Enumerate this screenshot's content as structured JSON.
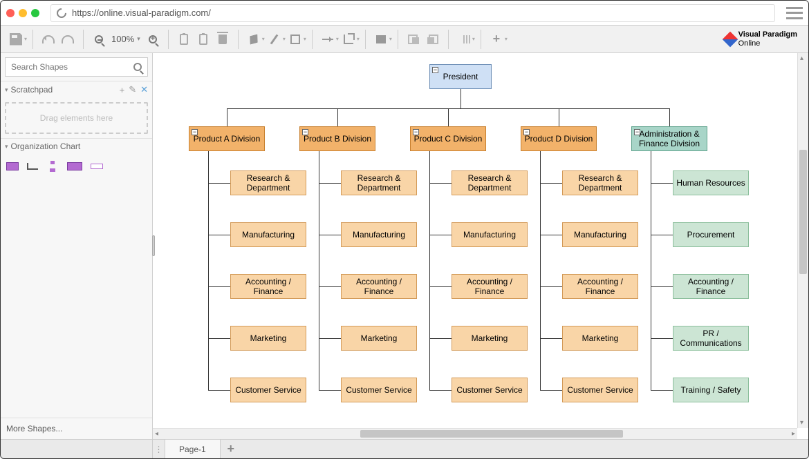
{
  "browser": {
    "url": "https://online.visual-paradigm.com/"
  },
  "toolbar": {
    "zoom": "100%"
  },
  "logo": {
    "line1": "Visual Paradigm",
    "line2": "Online"
  },
  "sidebar": {
    "search_placeholder": "Search Shapes",
    "scratchpad_title": "Scratchpad",
    "dropzone": "Drag elements here",
    "orgchart_title": "Organization Chart",
    "more_shapes": "More Shapes..."
  },
  "footer": {
    "page_tab": "Page-1"
  },
  "chart_data": {
    "type": "org_chart",
    "root": {
      "label": "President",
      "color": "blue"
    },
    "divisions": [
      {
        "label": "Product A Division",
        "color": "orange-dark",
        "children": [
          {
            "label": "Research & Department",
            "color": "orange-light"
          },
          {
            "label": "Manufacturing",
            "color": "orange-light"
          },
          {
            "label": "Accounting / Finance",
            "color": "orange-light"
          },
          {
            "label": "Marketing",
            "color": "orange-light"
          },
          {
            "label": "Customer Service",
            "color": "orange-light"
          }
        ]
      },
      {
        "label": "Product B Division",
        "color": "orange-dark",
        "children": [
          {
            "label": "Research & Department",
            "color": "orange-light"
          },
          {
            "label": "Manufacturing",
            "color": "orange-light"
          },
          {
            "label": "Accounting / Finance",
            "color": "orange-light"
          },
          {
            "label": "Marketing",
            "color": "orange-light"
          },
          {
            "label": "Customer Service",
            "color": "orange-light"
          }
        ]
      },
      {
        "label": "Product C Division",
        "color": "orange-dark",
        "children": [
          {
            "label": "Research & Department",
            "color": "orange-light"
          },
          {
            "label": "Manufacturing",
            "color": "orange-light"
          },
          {
            "label": "Accounting / Finance",
            "color": "orange-light"
          },
          {
            "label": "Marketing",
            "color": "orange-light"
          },
          {
            "label": "Customer Service",
            "color": "orange-light"
          }
        ]
      },
      {
        "label": "Product D Division",
        "color": "orange-dark",
        "children": [
          {
            "label": "Research & Department",
            "color": "orange-light"
          },
          {
            "label": "Manufacturing",
            "color": "orange-light"
          },
          {
            "label": "Accounting / Finance",
            "color": "orange-light"
          },
          {
            "label": "Marketing",
            "color": "orange-light"
          },
          {
            "label": "Customer Service",
            "color": "orange-light"
          }
        ]
      },
      {
        "label": "Administration & Finance Division",
        "color": "teal",
        "children": [
          {
            "label": "Human Resources",
            "color": "green"
          },
          {
            "label": "Procurement",
            "color": "green"
          },
          {
            "label": "Accounting / Finance",
            "color": "green"
          },
          {
            "label": "PR / Communications",
            "color": "green"
          },
          {
            "label": "Training / Safety",
            "color": "green"
          }
        ]
      }
    ]
  }
}
